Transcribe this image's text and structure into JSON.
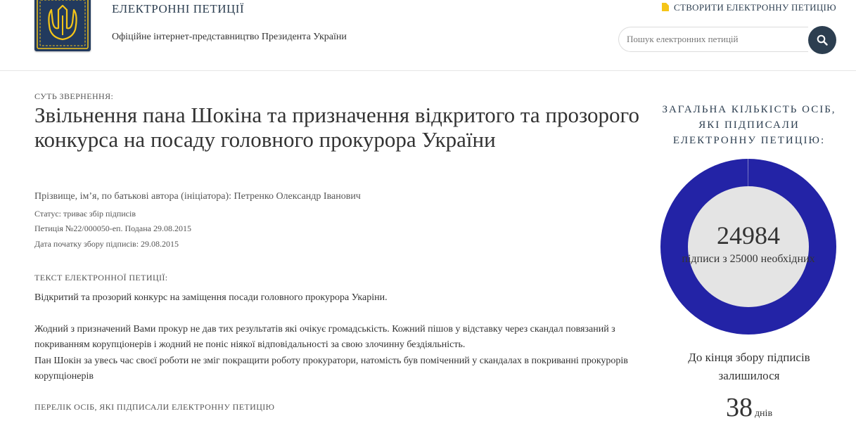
{
  "header": {
    "site_title": "ЕЛЕКТРОННІ ПЕТИЦІЇ",
    "site_subtitle": "Офіційне інтернет-представництво Президента України",
    "create_link": "СТВОРИТИ ЕЛЕКТРОННУ ПЕТИЦІЮ",
    "search_placeholder": "Пошук електронних петицій",
    "brand_color": "#223a5e",
    "accent_color": "#f5c518"
  },
  "petition": {
    "essence_label": "СУТЬ ЗВЕРНЕННЯ:",
    "title": "Звільнення пана Шокіна та призначення відкритого та прозорого конкурса на посаду головного прокурора України",
    "author": "Прізвище, ім’я, по батькові автора (ініціатора): Петренко Олександр Іванович",
    "status": "Статус: триває збір підписів",
    "number": "Петиція №22/000050-еп. Подана 29.08.2015",
    "start_date": "Дата початку збору підписів: 29.08.2015",
    "text_label": "ТЕКСТ ЕЛЕКТРОННОЇ ПЕТИЦІЇ:",
    "paragraphs": [
      "Відкритий та прозорий конкурс на заміщення посади головного прокурора Укаріни.",
      "Жодний з призначений Вами прокур не дав тих результатів які очікує громадськість. Кожний пішов у відставку через скандал повязаний з покриванням корупціонерів і жодний не поніс ніякої відповідальності за свою злочинну бездіяльність.",
      "Пан Шокін за увесь час своєї роботи не зміг покращити роботу прокуратори, натомість був поміченний у скандалах в покриванні прокурорів корупціонерів"
    ],
    "signers_link": "ПЕРЕЛІК ОСІБ, ЯКІ ПІДПИСАЛИ ЕЛЕКТРОННУ ПЕТИЦІЮ"
  },
  "sidebar": {
    "title": "ЗАГАЛЬНА КІЛЬКІСТЬ ОСІБ, ЯКІ ПІДПИСАЛИ ЕЛЕКТРОННУ ПЕТИЦІЮ:",
    "signatures": 24984,
    "signatures_text": "24984",
    "required": 25000,
    "required_text": "підписи з 25000 необхідних",
    "progress_color": "#2323a6",
    "remain_text": "До кінця збору підписів залишилося",
    "days_left": "38",
    "days_unit": "днів"
  }
}
